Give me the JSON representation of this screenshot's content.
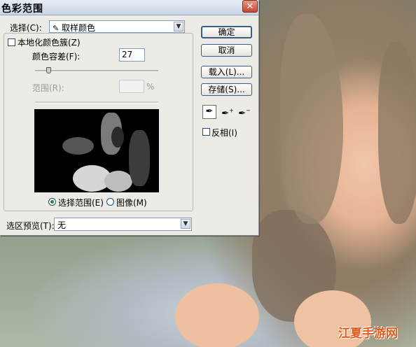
{
  "dialog": {
    "title": "色彩范围",
    "close_glyph": "✕",
    "select_label": "选择(C):",
    "select_value": "取样颜色",
    "select_icon": "eyedropper-icon",
    "localized_label": "本地化颜色簇(Z)",
    "localized_checked": false,
    "fuzziness_label": "颜色容差(F):",
    "fuzziness_value": "27",
    "fuzziness_level": 0.11,
    "range_label": "范围(R):",
    "range_value": "",
    "range_unit": "%",
    "radio_selection": "选择范围(E)",
    "radio_image": "图像(M)",
    "radio_selected": "selection",
    "preview_label": "选区预览(T):",
    "preview_value": "无"
  },
  "buttons": {
    "ok": "确定",
    "cancel": "取消",
    "load": "载入(L)...",
    "save": "存储(S)..."
  },
  "tools": [
    "eyedropper-icon",
    "eyedropper-plus-icon",
    "eyedropper-minus-icon"
  ],
  "invert_label": "反相(I)",
  "invert_checked": false,
  "watermark": "江夏手游网"
}
